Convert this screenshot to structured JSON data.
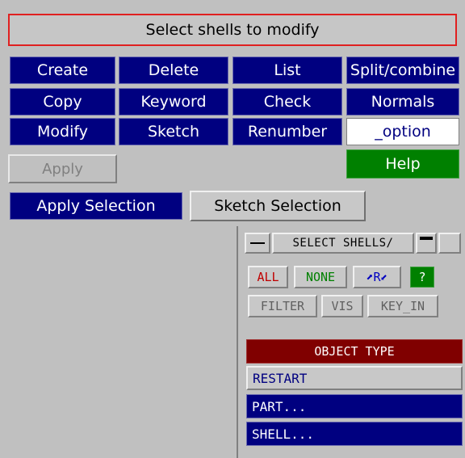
{
  "header": {
    "title": "Select shells to modify"
  },
  "grid": {
    "row1": [
      "Create",
      "Delete",
      "List",
      "Split/combine"
    ],
    "row2": [
      "Copy",
      "Keyword",
      "Check",
      "Normals"
    ],
    "row3": [
      "Modify",
      "Sketch",
      "Renumber",
      "_option"
    ]
  },
  "apply_label": "Apply",
  "help_label": "Help",
  "apply_selection_label": "Apply Selection",
  "sketch_selection_label": "Sketch Selection",
  "select_panel": {
    "title": "SELECT SHELLS/",
    "all": "ALL",
    "none": "NONE",
    "r": "R",
    "question": "?",
    "filter": "FILTER",
    "vis": "VIS",
    "key_in": "KEY_IN",
    "object_type_header": "OBJECT TYPE",
    "types": [
      "RESTART",
      "PART...",
      "SHELL..."
    ]
  },
  "colors": {
    "navy": "#000080",
    "green": "#008000",
    "dark_red": "#800000",
    "title_border": "#e02020"
  }
}
